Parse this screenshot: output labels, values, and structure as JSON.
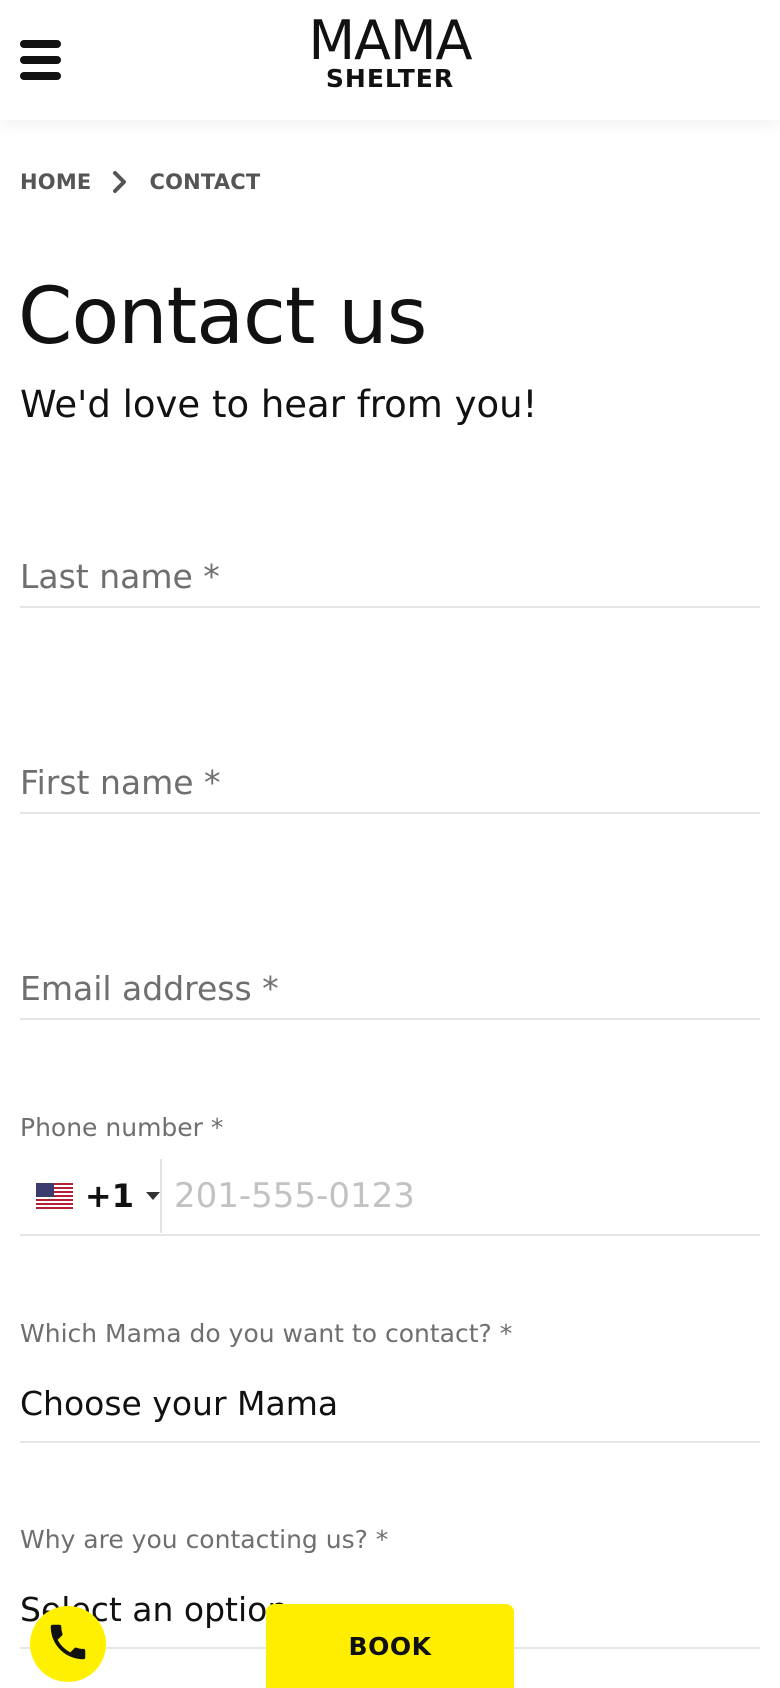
{
  "header": {
    "logo_top": "MAMA",
    "logo_bottom": "SHELTER",
    "menu_icon": "hamburger-menu-icon"
  },
  "breadcrumb": {
    "items": [
      "HOME",
      "CONTACT"
    ],
    "separator_icon": "chevron-right-icon"
  },
  "page": {
    "title": "Contact us",
    "subtitle": "We'd love to hear from you!"
  },
  "form": {
    "last_name": {
      "placeholder": "Last name *",
      "value": ""
    },
    "first_name": {
      "placeholder": "First name *",
      "value": ""
    },
    "email": {
      "placeholder": "Email address *",
      "value": ""
    },
    "phone": {
      "label": "Phone number *",
      "country_icon": "us-flag-icon",
      "dial_code": "+1",
      "placeholder": "201-555-0123",
      "value": ""
    },
    "mama": {
      "label": "Which Mama do you want to contact? *",
      "selected": "Choose your Mama"
    },
    "reason": {
      "label": "Why are you contacting us? *",
      "selected": "Select an option"
    }
  },
  "actions": {
    "call_icon": "phone-icon",
    "book_label": "BOOK"
  },
  "colors": {
    "accent_yellow": "#FFEE00",
    "text_dark": "#111111",
    "text_muted": "#6F6F6F",
    "divider": "#E6E6E6"
  }
}
